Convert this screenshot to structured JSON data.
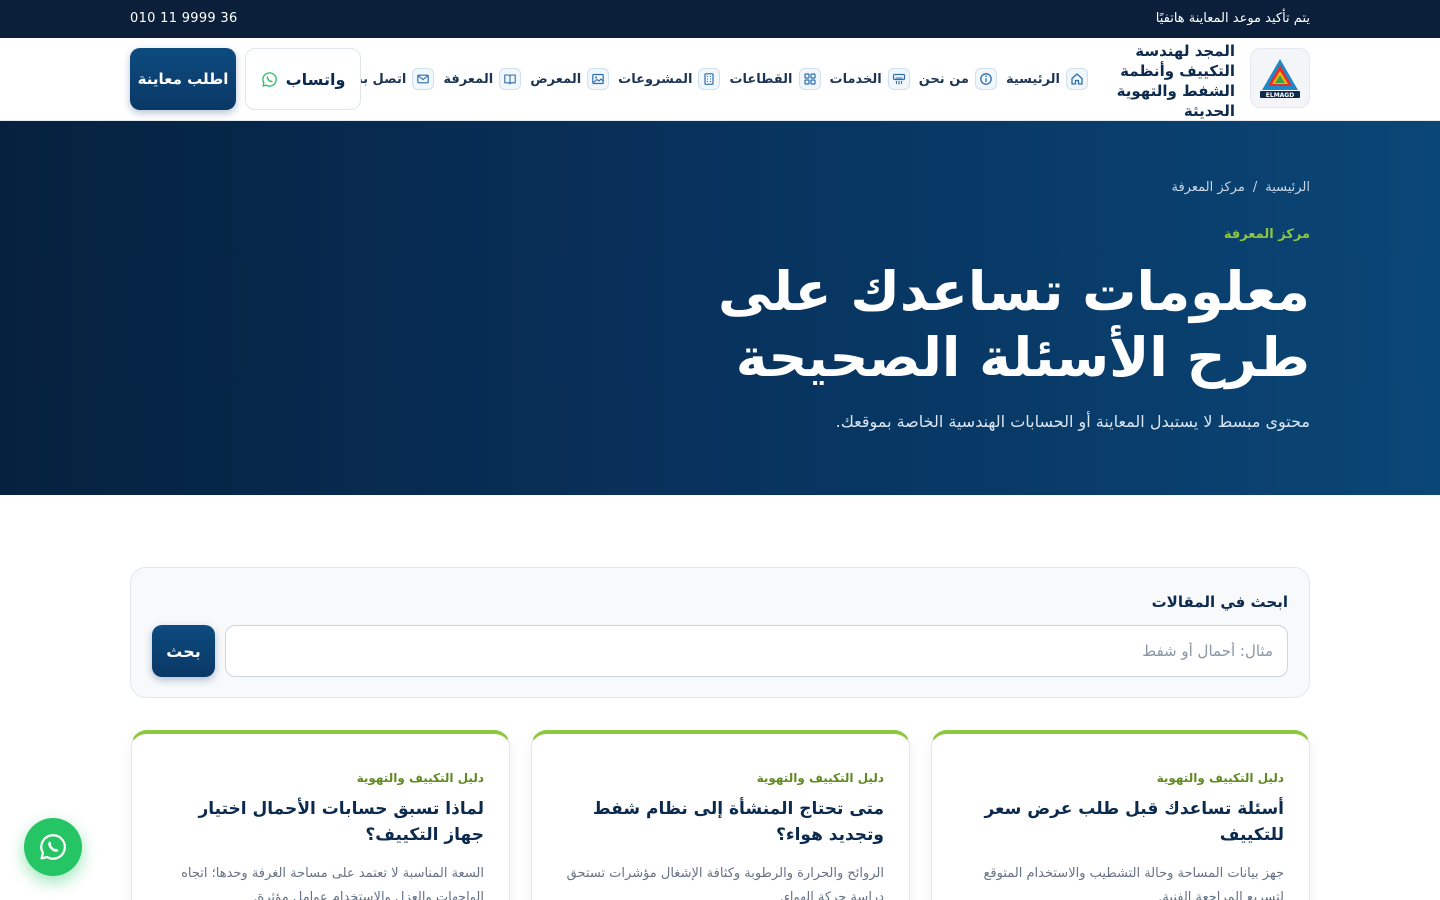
{
  "topbar": {
    "note": "يتم تأكيد موعد المعاينة هاتفيًا",
    "phone": "010 11 9999 36"
  },
  "brand": {
    "name": "المجد لهندسة التكييف وأنظمة الشفط والتهوية الحديثة",
    "logo_text": "ELMAGD"
  },
  "nav": {
    "items": [
      {
        "label": "الرئيسية",
        "icon": "home-icon"
      },
      {
        "label": "من نحن",
        "icon": "info-icon"
      },
      {
        "label": "الخدمات",
        "icon": "air-conditioner-icon"
      },
      {
        "label": "القطاعات",
        "icon": "grid-icon"
      },
      {
        "label": "المشروعات",
        "icon": "building-icon"
      },
      {
        "label": "المعرض",
        "icon": "image-icon"
      },
      {
        "label": "المعرفة",
        "icon": "book-icon"
      },
      {
        "label": "اتصل بنا",
        "icon": "mail-icon"
      }
    ]
  },
  "header": {
    "whatsapp_label": "واتساب",
    "request_label": "اطلب معاينة"
  },
  "hero": {
    "breadcrumb": [
      "الرئيسية",
      "/",
      "مركز المعرفة"
    ],
    "eyebrow": "مركز المعرفة",
    "title": "معلومات تساعدك على طرح الأسئلة الصحيحة",
    "subtitle": "محتوى مبسط لا يستبدل المعاينة أو الحسابات الهندسية الخاصة بموقعك."
  },
  "search": {
    "label": "ابحث في المقالات",
    "placeholder": "مثال: أحمال أو شفط",
    "button": "بحث"
  },
  "cards": [
    {
      "category": "دليل التكييف والتهوية",
      "title": "أسئلة تساعدك قبل طلب عرض سعر للتكييف",
      "excerpt": "جهز بيانات المساحة وحالة التشطيب والاستخدام المتوقع لتسريع المراجعة الفنية."
    },
    {
      "category": "دليل التكييف والتهوية",
      "title": "متى تحتاج المنشأة إلى نظام شفط وتجديد هواء؟",
      "excerpt": "الروائح والحرارة والرطوبة وكثافة الإشغال مؤشرات تستحق دراسة حركة الهواء."
    },
    {
      "category": "دليل التكييف والتهوية",
      "title": "لماذا تسبق حسابات الأحمال اختيار جهاز التكييف؟",
      "excerpt": "السعة المناسبة لا تعتمد على مساحة الغرفة وحدها؛ اتجاه الواجهات والعزل والاستخدام عوامل مؤثرة."
    }
  ],
  "colors": {
    "topbar": "#0c1f3a",
    "hero_start": "#06213f",
    "hero_end": "#0a4676",
    "accent_green": "#8dc63f",
    "primary_button": "#0a3866",
    "whatsapp_green": "#25c565"
  }
}
